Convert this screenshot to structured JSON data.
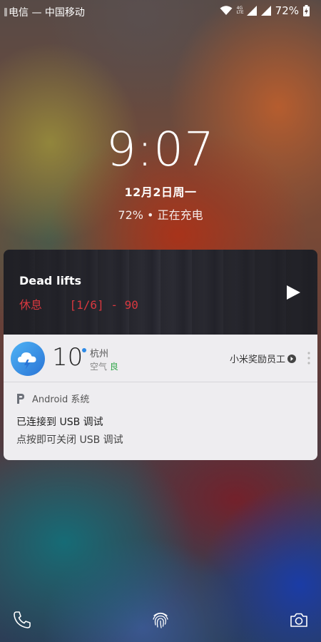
{
  "status_bar": {
    "carrier": "电信 — 中国移动",
    "network_badge_top": "4G",
    "network_badge_bottom": "LTE",
    "battery": "72%"
  },
  "lock": {
    "time": "9:07",
    "date": "12月2日周一",
    "charging": "72% • 正在充电"
  },
  "media": {
    "title": "Dead lifts",
    "subtitle": "休息    [1/6] - 90",
    "play_icon": "play-icon"
  },
  "weather": {
    "temperature": "10",
    "city": "杭州",
    "aqi_label": "空气",
    "aqi_level": "良",
    "link": "小米奖励员工",
    "icon": "cloud-lightning-icon",
    "accent": "#2d8ae6"
  },
  "system_notification": {
    "app": "Android 系统",
    "title": "已连接到 USB 调试",
    "body": "点按即可关闭 USB 调试"
  },
  "bottom": {
    "left_icon": "phone-icon",
    "center_icon": "fingerprint-icon",
    "right_icon": "camera-icon"
  }
}
